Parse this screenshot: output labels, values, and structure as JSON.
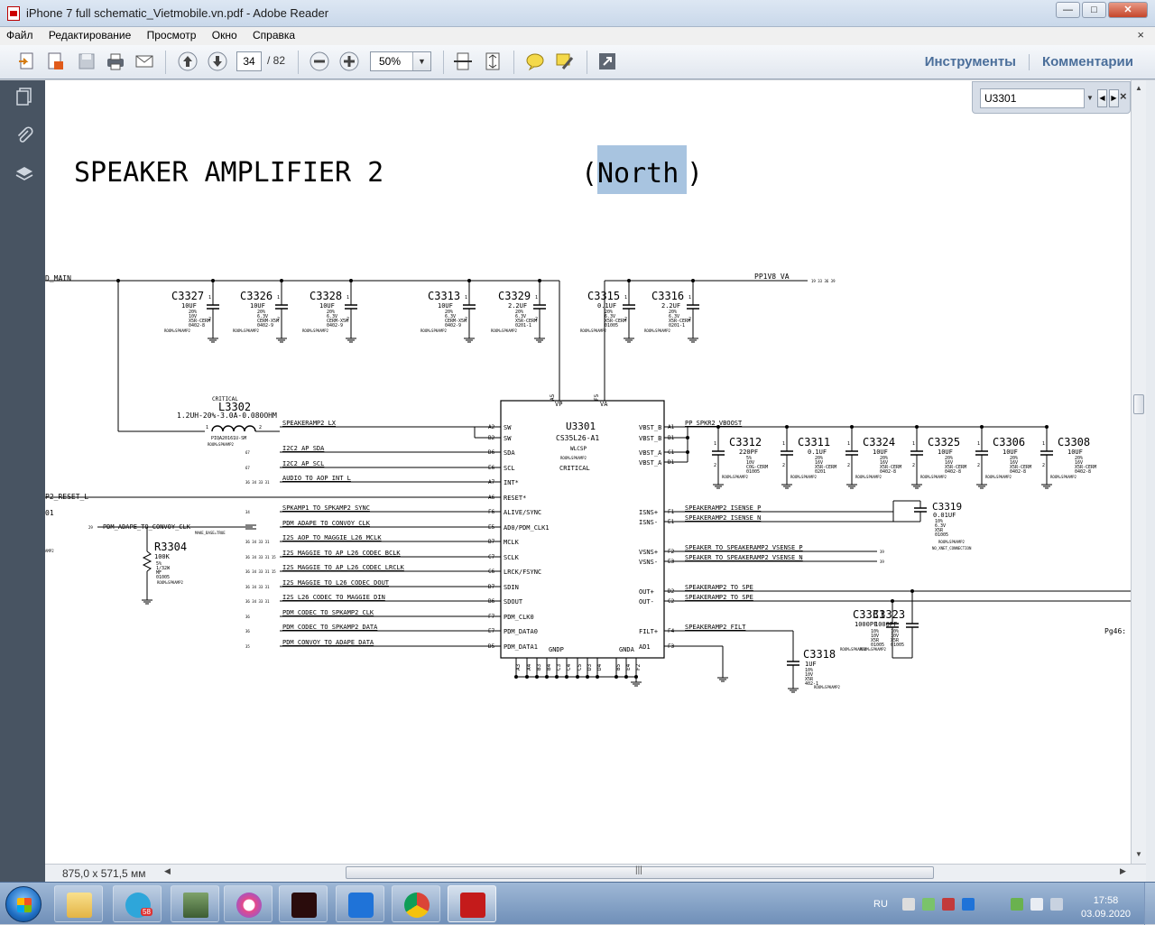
{
  "window": {
    "title": "iPhone 7 full schematic_Vietmobile.vn.pdf - Adobe Reader",
    "buttons": {
      "minimize": "—",
      "maximize": "□",
      "close": "✕"
    }
  },
  "menu": {
    "items": [
      "Файл",
      "Редактирование",
      "Просмотр",
      "Окно",
      "Справка"
    ],
    "close_glyph": "×"
  },
  "toolbar": {
    "page_current": "34",
    "page_total": "/ 82",
    "zoom": "50%",
    "tools_label": "Инструменты",
    "comments_label": "Комментарии"
  },
  "find": {
    "value": "U3301"
  },
  "status": {
    "page_size": "875,0 x 571,5 мм"
  },
  "taskbar": {
    "telegram_badge": "58",
    "lang": "RU",
    "time": "17:58",
    "date": "03.09.2020"
  },
  "schematic": {
    "title": "SPEAKER AMPLIFIER 2",
    "subtitle_open": "(",
    "subtitle_highlight": "North",
    "subtitle_close": ")",
    "rails": {
      "left": "D_MAIN",
      "right": "PP1V8_VA",
      "right_refs": "19 33 36 39"
    },
    "top_caps": [
      {
        "name": "C3327",
        "value": "10UF",
        "spec": [
          "20%",
          "10V",
          "X5R-CERM",
          "0402-8"
        ],
        "room": "ROOM=SPKAMP2"
      },
      {
        "name": "C3326",
        "value": "10UF",
        "spec": [
          "20%",
          "6.3V",
          "CERM-X5R",
          "0402-9"
        ],
        "room": "ROOM=SPKAMP2"
      },
      {
        "name": "C3328",
        "value": "10UF",
        "spec": [
          "20%",
          "6.3V",
          "CERM-X5R",
          "0402-9"
        ],
        "room": "ROOM=SPKAMP2"
      },
      {
        "name": "C3313",
        "value": "10UF",
        "spec": [
          "20%",
          "6.3V",
          "CERM-X5R",
          "0402-9"
        ],
        "room": "ROOM=SPKAMP2"
      },
      {
        "name": "C3329",
        "value": "2.2UF",
        "spec": [
          "20%",
          "6.3V",
          "X5R-CERM",
          "0201-1"
        ],
        "room": "ROOM=SPKAMP2"
      },
      {
        "name": "C3315",
        "value": "0.1UF",
        "spec": [
          "20%",
          "6.3V",
          "X5R-CERM",
          "01005"
        ],
        "room": "ROOM=SPKAMP2"
      },
      {
        "name": "C3316",
        "value": "2.2UF",
        "spec": [
          "20%",
          "6.3V",
          "X5R-CERM",
          "0201-1"
        ],
        "room": "ROOM=SPKAMP2"
      }
    ],
    "vbst_caps": [
      {
        "name": "C3312",
        "value": "220PF",
        "spec": [
          "5%",
          "10V",
          "C0G-CERM",
          "01005"
        ],
        "room": "ROOM=SPKAMP2"
      },
      {
        "name": "C3311",
        "value": "0.1UF",
        "spec": [
          "20%",
          "16V",
          "X5R-CERM",
          "0201"
        ],
        "room": "ROOM=SPKAMP2"
      },
      {
        "name": "C3324",
        "value": "10UF",
        "spec": [
          "20%",
          "16V",
          "X5R-CERM",
          "0402-8"
        ],
        "room": "ROOM=SPKAMP2"
      },
      {
        "name": "C3325",
        "value": "10UF",
        "spec": [
          "20%",
          "16V",
          "X5R-CERM",
          "0402-8"
        ],
        "room": "ROOM=SPKAMP2"
      },
      {
        "name": "C3306",
        "value": "10UF",
        "spec": [
          "20%",
          "16V",
          "X5R-CERM",
          "0402-8"
        ],
        "room": "ROOM=SPKAMP2"
      },
      {
        "name": "C3308",
        "value": "10UF",
        "spec": [
          "20%",
          "16V",
          "X5R-CERM",
          "0402-8"
        ],
        "room": "ROOM=SPKAMP2"
      }
    ],
    "inductor": {
      "critical": "CRITICAL",
      "name": "L3302",
      "value": "1.2UH-20%-3.0A-0.080OHM",
      "pkg": "PIQA20161U-SM",
      "room": "ROOM=SPKAMP2"
    },
    "ic": {
      "name": "U3301",
      "part": "CS35L26-A1",
      "pkg": "WLCSP",
      "room": "ROOM=SPKAMP2",
      "critical": "CRITICAL",
      "top_pins": [
        {
          "ball": "A5",
          "name": "VP"
        },
        {
          "ball": "F5",
          "name": "VA"
        }
      ],
      "left_pins": [
        {
          "ball": "A2",
          "name": "SW",
          "net": "SPEAKERAMP2_LX",
          "refs": ""
        },
        {
          "ball": "B2",
          "name": "SW",
          "net": "",
          "refs": ""
        },
        {
          "ball": "D6",
          "name": "SDA",
          "net": "I2C2_AP_SDA",
          "refs": "67"
        },
        {
          "ball": "E6",
          "name": "SCL",
          "net": "I2C2_AP_SCL",
          "refs": "67"
        },
        {
          "ball": "A7",
          "name": "INT*",
          "net": "AUDIO_TO_AOP_INT_L",
          "refs": "36 34 33 31"
        },
        {
          "ball": "A6",
          "name": "RESET*",
          "net": "",
          "refs": ""
        },
        {
          "ball": "F6",
          "name": "ALIVE/SYNC",
          "net": "SPKAMP1_TO_SPKAMP2_SYNC",
          "refs": "34"
        },
        {
          "ball": "E5",
          "name": "AD0/PDM_CLK1",
          "net": "PDM_ADAPE_TO_CONVOY_CLK",
          "refs": ""
        },
        {
          "ball": "B7",
          "name": "MCLK",
          "net": "I2S_AOP_TO_MAGGIE_L26_MCLK",
          "refs": "36 34 33 31"
        },
        {
          "ball": "C7",
          "name": "SCLK",
          "net": "I2S_MAGGIE_TO_AP_L26_CODEC_BCLK",
          "refs": "36 34 33 31 15"
        },
        {
          "ball": "C6",
          "name": "LRCK/FSYNC",
          "net": "I2S_MAGGIE_TO_AP_L26_CODEC_LRCLK",
          "refs": "36 34 33 31 15"
        },
        {
          "ball": "D7",
          "name": "SDIN",
          "net": "I2S_MAGGIE_TO_L26_CODEC_DOUT",
          "refs": "36 34 33 31"
        },
        {
          "ball": "B6",
          "name": "SDOUT",
          "net": "I2S_L26_CODEC_TO_MAGGIE_DIN",
          "refs": "36 34 33 31"
        },
        {
          "ball": "F7",
          "name": "PDM_CLK0",
          "net": "PDM_CODEC_TO_SPKAMP2_CLK",
          "refs": "36"
        },
        {
          "ball": "E7",
          "name": "PDM_DATA0",
          "net": "PDM_CODEC_TO_SPKAMP2_DATA",
          "refs": "36"
        },
        {
          "ball": "D5",
          "name": "PDM_DATA1",
          "net": "PDM_CONVOY_TO_ADAPE_DATA",
          "refs": "35"
        }
      ],
      "right_pins": [
        {
          "ball": "B1",
          "name": "VBST_B",
          "net": "PP_SPKR2_VBOOST",
          "refs": ""
        },
        {
          "ball": "B1",
          "name": "VBST_B",
          "net": "",
          "refs": ""
        },
        {
          "ball": "C1",
          "name": "VBST_A",
          "net": "",
          "refs": ""
        },
        {
          "ball": "D1",
          "name": "VBST_A",
          "net": "",
          "refs": ""
        },
        {
          "ball": "F1",
          "name": "ISNS+",
          "net": "SPEAKERAMP2_ISENSE_P",
          "refs": ""
        },
        {
          "ball": "E1",
          "name": "ISNS-",
          "net": "SPEAKERAMP2_ISENSE_N",
          "refs": ""
        },
        {
          "ball": "F2",
          "name": "VSNS+",
          "net": "SPEAKER_TO_SPEAKERAMP2_VSENSE_P",
          "refs": "39"
        },
        {
          "ball": "E3",
          "name": "VSNS-",
          "net": "SPEAKER_TO_SPEAKERAMP2_VSENSE_N",
          "refs": "39"
        },
        {
          "ball": "D2",
          "name": "OUT+",
          "net": "SPEAKERAMP2_TO_SPE",
          "refs": ""
        },
        {
          "ball": "C2",
          "name": "OUT-",
          "net": "SPEAKERAMP2_TO_SPE",
          "refs": ""
        },
        {
          "ball": "F4",
          "name": "FILT+",
          "net": "SPEAKERAMP2_FILT",
          "refs": ""
        },
        {
          "ball": "F3",
          "name": "AD1",
          "net": "",
          "refs": ""
        }
      ],
      "first_right_ball": "A1",
      "bottom_gnd_label": "GNDP",
      "bottom_gnda_label": "GNDA",
      "bottom_balls": [
        "A3",
        "A4",
        "B3",
        "B4",
        "C3",
        "C4",
        "C5",
        "D3",
        "D4",
        "B5",
        "E4",
        "F2"
      ]
    },
    "c3319": {
      "name": "C3319",
      "value": "0.01UF",
      "spec": [
        "10%",
        "6.3V",
        "X5R",
        "01005"
      ],
      "room": "ROOM=SPKAMP2",
      "note": "NO_XNET_CONNECTION"
    },
    "c3331": {
      "name": "C3331",
      "value": "1000PF",
      "spec": [
        "10%",
        "10V",
        "X5R",
        "01005"
      ],
      "room": "ROOM=SPKAMP2"
    },
    "c3323": {
      "name": "C3323",
      "value": "1000PF",
      "spec": [
        "10%",
        "10V",
        "X5R",
        "01005"
      ],
      "room": "ROOM=SPKAMP2"
    },
    "c3318": {
      "name": "C3318",
      "value": "1UF",
      "spec": [
        "10%",
        "10V",
        "X5R",
        "402-1"
      ],
      "room": "ROOM=SPKAMP2"
    },
    "r3304": {
      "name": "R3304",
      "value": "100K",
      "spec": [
        "5%",
        "1/32W",
        "MF",
        "01005"
      ],
      "room": "ROOM=SPKAMP2"
    },
    "left_misc": {
      "reset_net": "P2_RESET_L",
      "d1_label": "01",
      "pdm_refs": "29",
      "pdm_note": "MAKE_BASE=TRUE",
      "amp2_label": "AMP2"
    },
    "page_ref": "Pg46:",
    "pin_numbers": {
      "one": "1",
      "two": "2"
    }
  }
}
